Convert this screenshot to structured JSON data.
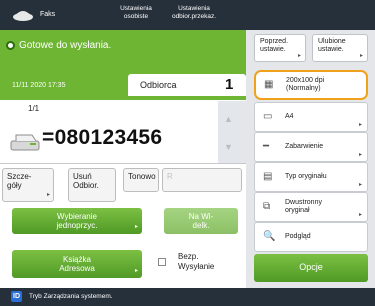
{
  "header": {
    "app_name": "Faks",
    "tab_settings_line1": "Ustawienia",
    "tab_settings_line2": "osobiste",
    "tab_recipients_line1": "Ustawienia",
    "tab_recipients_line2": "odbior.przekaz."
  },
  "status": {
    "ready_text": "Gotowe do wysłania.",
    "datetime": "11/11 2020 17:35"
  },
  "recipient": {
    "label": "Odbiorca",
    "count": "1"
  },
  "entry": {
    "counter": "1/1",
    "fax_number": "=080123456"
  },
  "buttons": {
    "details_line1": "Szcze-",
    "details_line2": "góły",
    "delete_line1": "Usuń",
    "delete_line2": "Odbior.",
    "tone": "Tonowo",
    "r_key": "R",
    "dial_line1": "Wybieranie",
    "dial_line2": "jednoprzyc.",
    "onhook_line1": "Na Wi-",
    "onhook_line2": "delk.",
    "addressbook_line1": "Książka",
    "addressbook_line2": "Adresowa",
    "secure_line1": "Bezp.",
    "secure_line2": "Wysyłanie"
  },
  "side_panel": {
    "previous_line1": "Poprzed.",
    "previous_line2": "ustawie.",
    "favorites_line1": "Ulubione",
    "favorites_line2": "ustawie.",
    "resolution_line1": "200x100 dpi",
    "resolution_line2": "(Normalny)",
    "paper_size": "A4",
    "stapling": "Zabarwienie",
    "original_type": "Typ oryginału",
    "duplex_line1": "Dwustronny",
    "duplex_line2": "oryginał",
    "preview": "Podgląd",
    "options": "Opcje"
  },
  "footer": {
    "system_icon": "ID",
    "system_message": "Tryb Zarządzania systemem."
  },
  "colors": {
    "accent_green": "#6eb534",
    "highlight_orange": "#f0a11c",
    "dark_bar": "#26303a"
  }
}
